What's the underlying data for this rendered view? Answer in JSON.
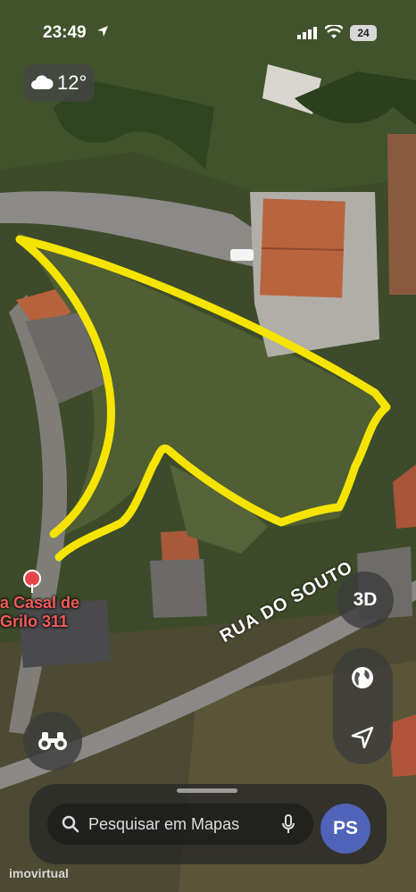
{
  "status_bar": {
    "time": "23:49",
    "battery": "24"
  },
  "weather": {
    "temperature": "12°",
    "icon": "cloud-icon"
  },
  "map": {
    "street_label": "RUA DO SOUTO",
    "poi": {
      "name_line1": "a Casal de",
      "name_line2": "Grilo 311",
      "icon": "pin-icon"
    },
    "parcel_outline_color": "#f5e400"
  },
  "controls": {
    "three_d_label": "3D"
  },
  "search": {
    "placeholder": "Pesquisar em Mapas",
    "avatar_initials": "PS"
  },
  "watermark": "imovirtual"
}
